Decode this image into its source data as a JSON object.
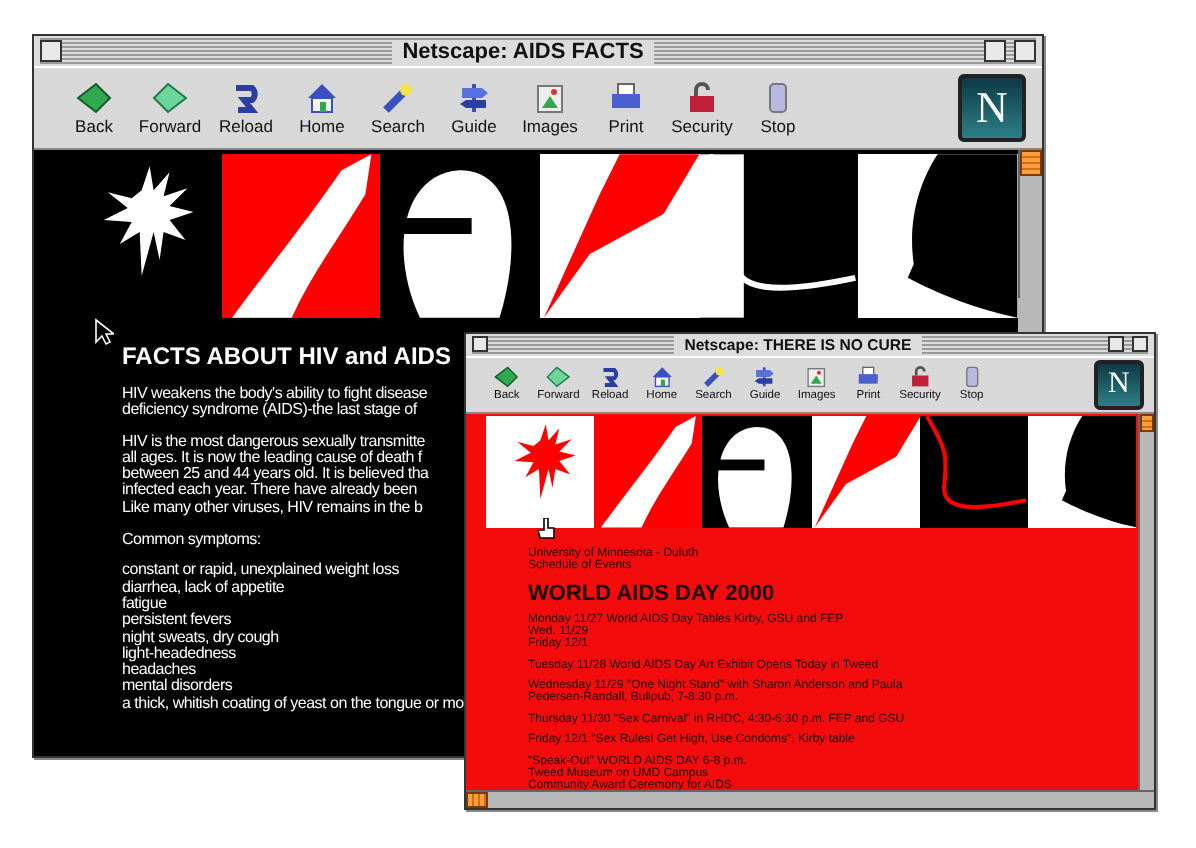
{
  "windows": [
    {
      "kind": "dark",
      "title": "Netscape: AIDS FACTS",
      "toolbar": [
        "Back",
        "Forward",
        "Reload",
        "Home",
        "Search",
        "Guide",
        "Images",
        "Print",
        "Security",
        "Stop"
      ],
      "logo_letter": "N",
      "page": {
        "heading": "FACTS ABOUT HIV and AIDS",
        "blocks": [
          [
            "HIV weakens the body's ability to fight disease",
            "deficiency syndrome (AIDS)-the last stage of"
          ],
          [
            "HIV is the most dangerous sexually transmitte",
            "all ages. It is now the leading cause of death f",
            "between 25 and 44 years old. It is believed tha",
            "infected each year. There have already been",
            "Like many other viruses, HIV remains in the b"
          ],
          [
            "Common symptoms:"
          ],
          [
            "constant or rapid, unexplained weight loss",
            "diarrhea, lack of appetite",
            "fatigue",
            "persistent fevers",
            "night sweats, dry cough",
            "light-headedness",
            "headaches",
            "mental disorders",
            "a thick, whitish coating of yeast on the tongue or mo"
          ]
        ]
      }
    },
    {
      "kind": "red",
      "title": "Netscape: THERE IS NO CURE",
      "toolbar": [
        "Back",
        "Forward",
        "Reload",
        "Home",
        "Search",
        "Guide",
        "Images",
        "Print",
        "Security",
        "Stop"
      ],
      "logo_letter": "N",
      "page": {
        "intro": [
          "University of Minnesota - Duluth",
          "Schedule of Events"
        ],
        "heading": "WORLD AIDS DAY 2000",
        "blocks": [
          [
            "Monday 11/27 World AIDS Day Tables Kirby, GSU and FEP",
            "Wed. 11/29",
            "Friday 12/1"
          ],
          [
            "Tuesday 11/28 World AIDS Day Art Exhibit Opens Today in Tweed"
          ],
          [
            "Wednesday 11/29 \"One Night Stand\" with Sharon Anderson and Paula",
            "Pedersen-Randall, Bullpub, 7-8:30 p.m."
          ],
          [
            "Thursday 11/30 \"Sex Carnival\" in RHDC, 4:30-6:30 p.m. FEP and GSU"
          ],
          [
            "Friday 12/1 \"Sex Rules! Get High, Use Condoms\", Kirby table"
          ],
          [
            "\"Speak-Out\" WORLD AIDS DAY 6-8 p.m.",
            "Tweed Museum on UMD Campus",
            "Community Award Ceremony for AIDS"
          ]
        ]
      }
    }
  ]
}
